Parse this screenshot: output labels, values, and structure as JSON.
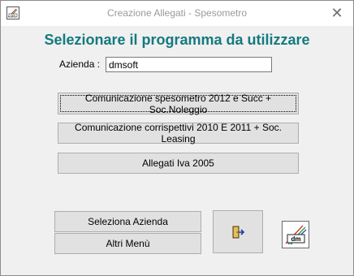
{
  "window": {
    "title": "Creazione Allegati - Spesometro",
    "close_glyph": "✕",
    "icon": "dms-app-icon"
  },
  "main": {
    "heading": "Selezionare il programma da utilizzare",
    "azienda_label": "Azienda :",
    "azienda_value": "dmsoft"
  },
  "buttons": {
    "spesometro": "Comunicazione spesometro 2012 e Succ + Soc.Noleggio",
    "corrispettivi": "Comunicazione corrispettivi 2010 E 2011 + Soc. Leasing",
    "allegati_iva": "Allegati Iva 2005",
    "seleziona_azienda": "Seleziona Azienda",
    "altri_menu": "Altri Menù"
  },
  "icons": {
    "exit": "exit-door-icon",
    "logo": "dms-logo-icon"
  },
  "colors": {
    "heading": "#137a7f",
    "button_face": "#e1e1e1"
  }
}
